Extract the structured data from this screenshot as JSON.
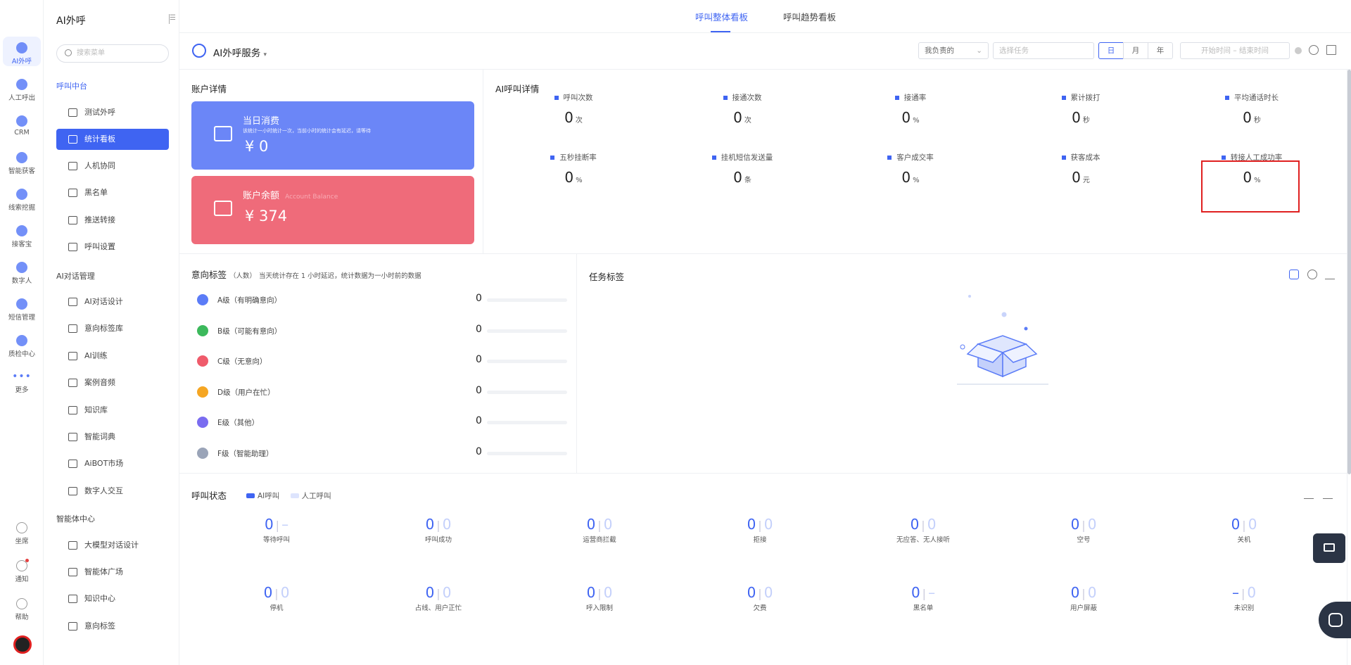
{
  "rail": [
    {
      "label": "AI外呼",
      "active": true
    },
    {
      "label": "人工呼出"
    },
    {
      "label": "CRM"
    },
    {
      "label": "智能获客"
    },
    {
      "label": "线索挖掘"
    },
    {
      "label": "接客宝"
    },
    {
      "label": "数字人"
    },
    {
      "label": "短信管理"
    },
    {
      "label": "质检中心"
    },
    {
      "label": "更多"
    }
  ],
  "rail_bottom": [
    {
      "label": "坐席"
    },
    {
      "label": "通知"
    },
    {
      "label": "帮助"
    }
  ],
  "menu": {
    "title": "AI外呼",
    "search_placeholder": "搜索菜单",
    "groups": [
      {
        "title": "呼叫中台",
        "items": [
          "测试外呼",
          "统计看板",
          "人机协同",
          "黑名单",
          "推送转接",
          "呼叫设置"
        ]
      },
      {
        "title": "AI对话管理",
        "items": [
          "AI对话设计",
          "意向标签库",
          "AI训练",
          "案例音频",
          "知识库",
          "智能词典",
          "AiBOT市场",
          "数字人交互"
        ]
      },
      {
        "title": "智能体中心",
        "items": [
          "大模型对话设计",
          "智能体广场",
          "知识中心",
          "意向标签"
        ]
      }
    ],
    "active_item": "统计看板"
  },
  "tabs": [
    "呼叫整体看板",
    "呼叫趋势看板"
  ],
  "toolbar": {
    "service": "AI外呼服务",
    "owner_select": "我负责的",
    "task_placeholder": "选择任务",
    "segments": [
      "日",
      "月",
      "年"
    ],
    "start_placeholder": "开始时间",
    "range_sep": "–",
    "end_placeholder": "结束时间"
  },
  "account": {
    "title": "账户详情",
    "today_title": "当日消费",
    "today_sub": "该统计一小时统计一次，当前小时的统计会有延迟，请等待",
    "today_value": "¥ 0",
    "balance_title": "账户余额",
    "balance_sub": "Account Balance",
    "balance_value": "¥ 374"
  },
  "ai_detail": {
    "title": "AI呼叫详情",
    "metrics": [
      {
        "label": "呼叫次数",
        "value": "0",
        "unit": "次"
      },
      {
        "label": "接通次数",
        "value": "0",
        "unit": "次"
      },
      {
        "label": "接通率",
        "value": "0",
        "unit": "%"
      },
      {
        "label": "累计拨打",
        "value": "0",
        "unit": "秒"
      },
      {
        "label": "平均通话时长",
        "value": "0",
        "unit": "秒"
      },
      {
        "label": "五秒挂断率",
        "value": "0",
        "unit": "%"
      },
      {
        "label": "挂机短信发送量",
        "value": "0",
        "unit": "条"
      },
      {
        "label": "客户成交率",
        "value": "0",
        "unit": "%"
      },
      {
        "label": "获客成本",
        "value": "0",
        "unit": "元"
      },
      {
        "label": "转接人工成功率",
        "value": "0",
        "unit": "%"
      }
    ]
  },
  "intent": {
    "title": "意向标签",
    "unit_note": "（人数）",
    "desc": "当天统计存在 1 小时延迟，统计数据为一小时前的数据",
    "rows": [
      {
        "label": "A级（有明确意向）",
        "value": "0",
        "color": "#5b7cf7"
      },
      {
        "label": "B级（可能有意向）",
        "value": "0",
        "color": "#3cb95c"
      },
      {
        "label": "C级（无意向）",
        "value": "0",
        "color": "#ef5b6b"
      },
      {
        "label": "D级（用户在忙）",
        "value": "0",
        "color": "#f5a623"
      },
      {
        "label": "E级（其他）",
        "value": "0",
        "color": "#7a6cf0"
      },
      {
        "label": "F级（智能助理）",
        "value": "0",
        "color": "#9aa4b8"
      }
    ]
  },
  "task_tags": {
    "title": "任务标签"
  },
  "call_status": {
    "title": "呼叫状态",
    "legend": [
      "AI呼叫",
      "人工呼叫"
    ],
    "items": [
      {
        "label": "等待呼叫",
        "ai": "0",
        "manual": "–"
      },
      {
        "label": "呼叫成功",
        "ai": "0",
        "manual": "0"
      },
      {
        "label": "运营商拦截",
        "ai": "0",
        "manual": "0"
      },
      {
        "label": "拒接",
        "ai": "0",
        "manual": "0"
      },
      {
        "label": "无应答、无人接听",
        "ai": "0",
        "manual": "0"
      },
      {
        "label": "空号",
        "ai": "0",
        "manual": "0"
      },
      {
        "label": "关机",
        "ai": "0",
        "manual": "0"
      },
      {
        "label": "停机",
        "ai": "0",
        "manual": "0"
      },
      {
        "label": "占线、用户正忙",
        "ai": "0",
        "manual": "0"
      },
      {
        "label": "呼入限制",
        "ai": "0",
        "manual": "0"
      },
      {
        "label": "欠费",
        "ai": "0",
        "manual": "0"
      },
      {
        "label": "黑名单",
        "ai": "0",
        "manual": "–"
      },
      {
        "label": "用户屏蔽",
        "ai": "0",
        "manual": "0"
      },
      {
        "label": "未识别",
        "ai": "–",
        "manual": "0"
      }
    ]
  },
  "colors": {
    "accent": "#3f64f2",
    "today_card": "#6b86f7",
    "balance_card": "#ef6b7a",
    "highlight": "#e02020"
  }
}
